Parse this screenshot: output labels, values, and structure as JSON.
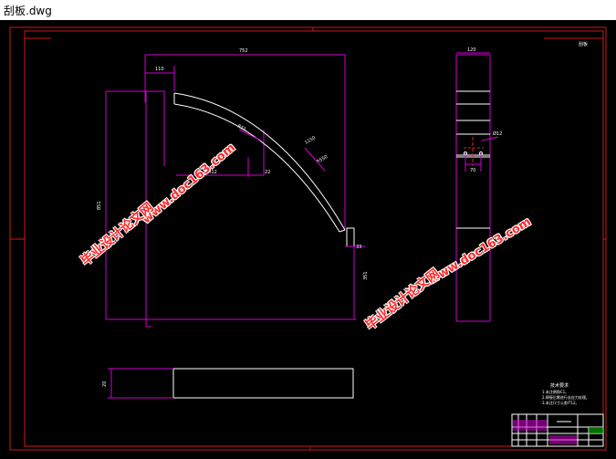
{
  "window": {
    "title": "刮板.dwg"
  },
  "colors": {
    "frame": "#d01818",
    "dims": "#d000d0",
    "outline": "#ffffff",
    "center": "#e02020",
    "watermark": "#ff2a2a"
  },
  "drawing": {
    "dims": {
      "top_width": "752",
      "notch_width": "110",
      "radius_label": "R55",
      "arc_label_1": "1150",
      "arc_label_2": "R550",
      "notch_height_label": "22",
      "notch_mid_label": "R12",
      "tip_label": "33",
      "left_height": "851",
      "bottom_right_height": "351",
      "side_width": "120",
      "side_bottom_width": "70",
      "side_hole_label": "Ø12",
      "bottom_view_height": "20"
    },
    "corner_label": "刮板"
  },
  "notes": {
    "title": "技术要求",
    "lines": [
      "1.未注倒角C1。",
      "2.焊接后需进行去应力处理。",
      "3.未注尺寸公差IT12。"
    ]
  },
  "watermarks": {
    "site": "www.doc163.com",
    "name": "毕业设计论文网"
  }
}
